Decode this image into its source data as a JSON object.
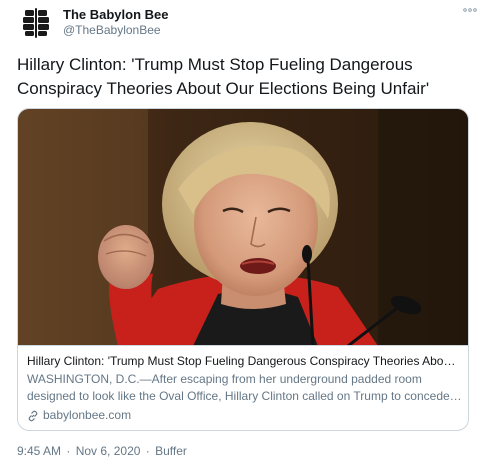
{
  "author": {
    "name": "The Babylon Bee",
    "handle": "@TheBabylonBee",
    "avatar_icon": "bee-logo-icon",
    "avatar_color": "#1a1a1a",
    "more_icon": "more-options-icon"
  },
  "tweet": {
    "text": "Hillary Clinton: 'Trump Must Stop Fueling Dangerous Conspiracy Theories About Our Elections Being Unfair'"
  },
  "card": {
    "title": "Hillary Clinton: 'Trump Must Stop Fueling Dangerous Conspiracy Theories About ...",
    "description_line1": "WASHINGTON, D.C.—After escaping from her underground padded room",
    "description_line2": "designed to look like the Oval Office, Hillary Clinton called on Trump to concede ...",
    "domain": "babylonbee.com",
    "domain_icon": "link-icon",
    "image": "photo of a woman speaking at a podium with raised fist"
  },
  "meta": {
    "time": "9:45 AM",
    "date": "Nov 6, 2020",
    "source": "Buffer"
  },
  "colors": {
    "text_primary": "#14171a",
    "text_secondary": "#657786",
    "border": "#ccd6dd"
  }
}
